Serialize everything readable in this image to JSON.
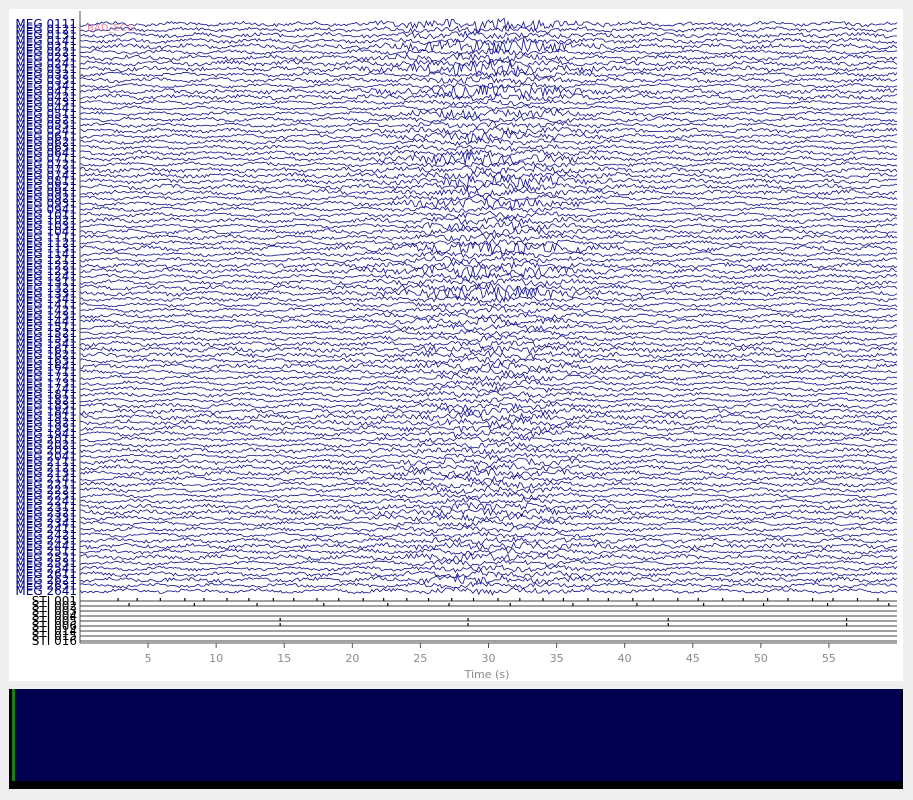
{
  "colors": {
    "meg_trace": "#10108c",
    "stim_trace": "#000000",
    "meg_label": "#00008b",
    "stim_label": "#000000",
    "axis_text": "#8a8a8a",
    "annotation": "#d66a8a",
    "scrollbar_fill": "#00004e",
    "scrollbar_cursor": "#1f7a1f"
  },
  "chart_data": {
    "type": "line",
    "xlabel": "Time (s)",
    "xlim": [
      0,
      60
    ],
    "xticks": [
      5,
      10,
      15,
      20,
      25,
      30,
      35,
      40,
      45,
      50,
      55
    ],
    "meg_channels": [
      "MEG 0111",
      "MEG 0121",
      "MEG 0131",
      "MEG 0141",
      "MEG 0211",
      "MEG 0221",
      "MEG 0231",
      "MEG 0241",
      "MEG 0311",
      "MEG 0321",
      "MEG 0331",
      "MEG 0341",
      "MEG 0411",
      "MEG 0421",
      "MEG 0431",
      "MEG 0441",
      "MEG 0511",
      "MEG 0521",
      "MEG 0531",
      "MEG 0541",
      "MEG 0611",
      "MEG 0621",
      "MEG 0631",
      "MEG 0641",
      "MEG 0711",
      "MEG 0721",
      "MEG 0731",
      "MEG 0741",
      "MEG 0811",
      "MEG 0821",
      "MEG 0911",
      "MEG 0921",
      "MEG 0931",
      "MEG 0941",
      "MEG 1011",
      "MEG 1021",
      "MEG 1031",
      "MEG 1041",
      "MEG 1111",
      "MEG 1121",
      "MEG 1131",
      "MEG 1141",
      "MEG 1211",
      "MEG 1221",
      "MEG 1231",
      "MEG 1241",
      "MEG 1311",
      "MEG 1321",
      "MEG 1331",
      "MEG 1341",
      "MEG 1411",
      "MEG 1421",
      "MEG 1431",
      "MEG 1441",
      "MEG 1511",
      "MEG 1521",
      "MEG 1531",
      "MEG 1541",
      "MEG 1611",
      "MEG 1621",
      "MEG 1631",
      "MEG 1641",
      "MEG 1711",
      "MEG 1721",
      "MEG 1731",
      "MEG 1741",
      "MEG 1811",
      "MEG 1821",
      "MEG 1831",
      "MEG 1841",
      "MEG 1911",
      "MEG 1921",
      "MEG 1931",
      "MEG 1941",
      "MEG 2011",
      "MEG 2021",
      "MEG 2031",
      "MEG 2041",
      "MEG 2111",
      "MEG 2121",
      "MEG 2131",
      "MEG 2141",
      "MEG 2211",
      "MEG 2221",
      "MEG 2231",
      "MEG 2241",
      "MEG 2311",
      "MEG 2321",
      "MEG 2331",
      "MEG 2341",
      "MEG 2411",
      "MEG 2421",
      "MEG 2431",
      "MEG 2441",
      "MEG 2511",
      "MEG 2521",
      "MEG 2531",
      "MEG 2541",
      "MEG 2611",
      "MEG 2621",
      "MEG 2631",
      "MEG 2641"
    ],
    "stim_channels": [
      "STI 001",
      "STI 002",
      "STI 003",
      "STI 004",
      "STI 005",
      "STI 006",
      "STI 014",
      "STI 015",
      "STI 016"
    ],
    "stim_events": [
      [
        2.8,
        4.2,
        5.9,
        7.7,
        9.1,
        10.8,
        12.4,
        14.2,
        15.7,
        17.4,
        19.0,
        20.8,
        22.3,
        24.0,
        25.6,
        27.3,
        28.9,
        30.7,
        32.3,
        34.0,
        35.5,
        37.3,
        38.8,
        40.6,
        42.1,
        43.9,
        45.4,
        47.2,
        48.7,
        50.5,
        52.0,
        53.8,
        55.3,
        57.1,
        58.6
      ],
      [
        3.6,
        8.4,
        13.0,
        17.9,
        22.6,
        27.1,
        31.6,
        36.2,
        40.9,
        45.8,
        50.2,
        54.9,
        59.4
      ],
      [],
      [],
      [
        14.7,
        28.5,
        43.2,
        56.3
      ],
      [
        14.7,
        28.5,
        43.2,
        56.3
      ],
      [],
      [],
      []
    ],
    "annotation_text": "BAD_ECG"
  }
}
